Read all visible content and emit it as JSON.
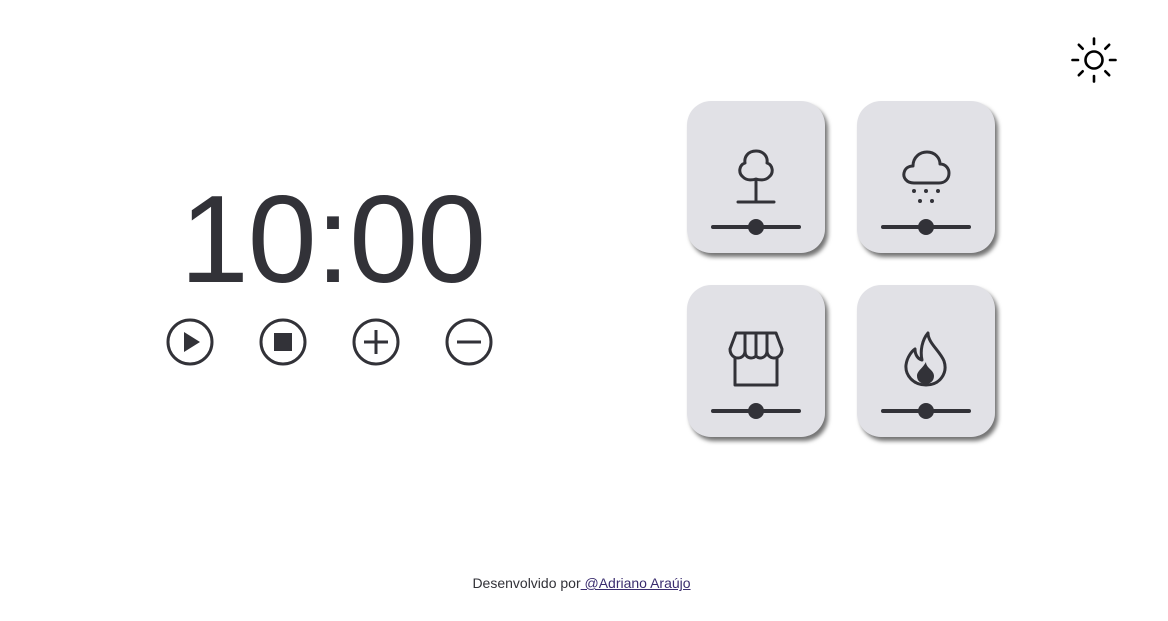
{
  "timer": {
    "display": "10:00"
  },
  "controls": [
    {
      "name": "play",
      "icon": "play-icon"
    },
    {
      "name": "stop",
      "icon": "stop-icon"
    },
    {
      "name": "increase",
      "icon": "plus-icon"
    },
    {
      "name": "decrease",
      "icon": "minus-icon"
    }
  ],
  "sounds": [
    {
      "name": "forest",
      "icon": "tree-icon",
      "volume": 0.5
    },
    {
      "name": "rain",
      "icon": "rain-cloud-icon",
      "volume": 0.5
    },
    {
      "name": "coffee-shop",
      "icon": "storefront-icon",
      "volume": 0.5
    },
    {
      "name": "fireplace",
      "icon": "fire-icon",
      "volume": 0.5
    }
  ],
  "theme": {
    "icon": "sun-icon"
  },
  "footer": {
    "prefix": "Desenvolvido por",
    "link_text": " @Adriano Araújo"
  },
  "colors": {
    "text": "#323238",
    "card_bg": "#e1e1e6",
    "link": "#3a2c6e",
    "background": "#ffffff"
  }
}
